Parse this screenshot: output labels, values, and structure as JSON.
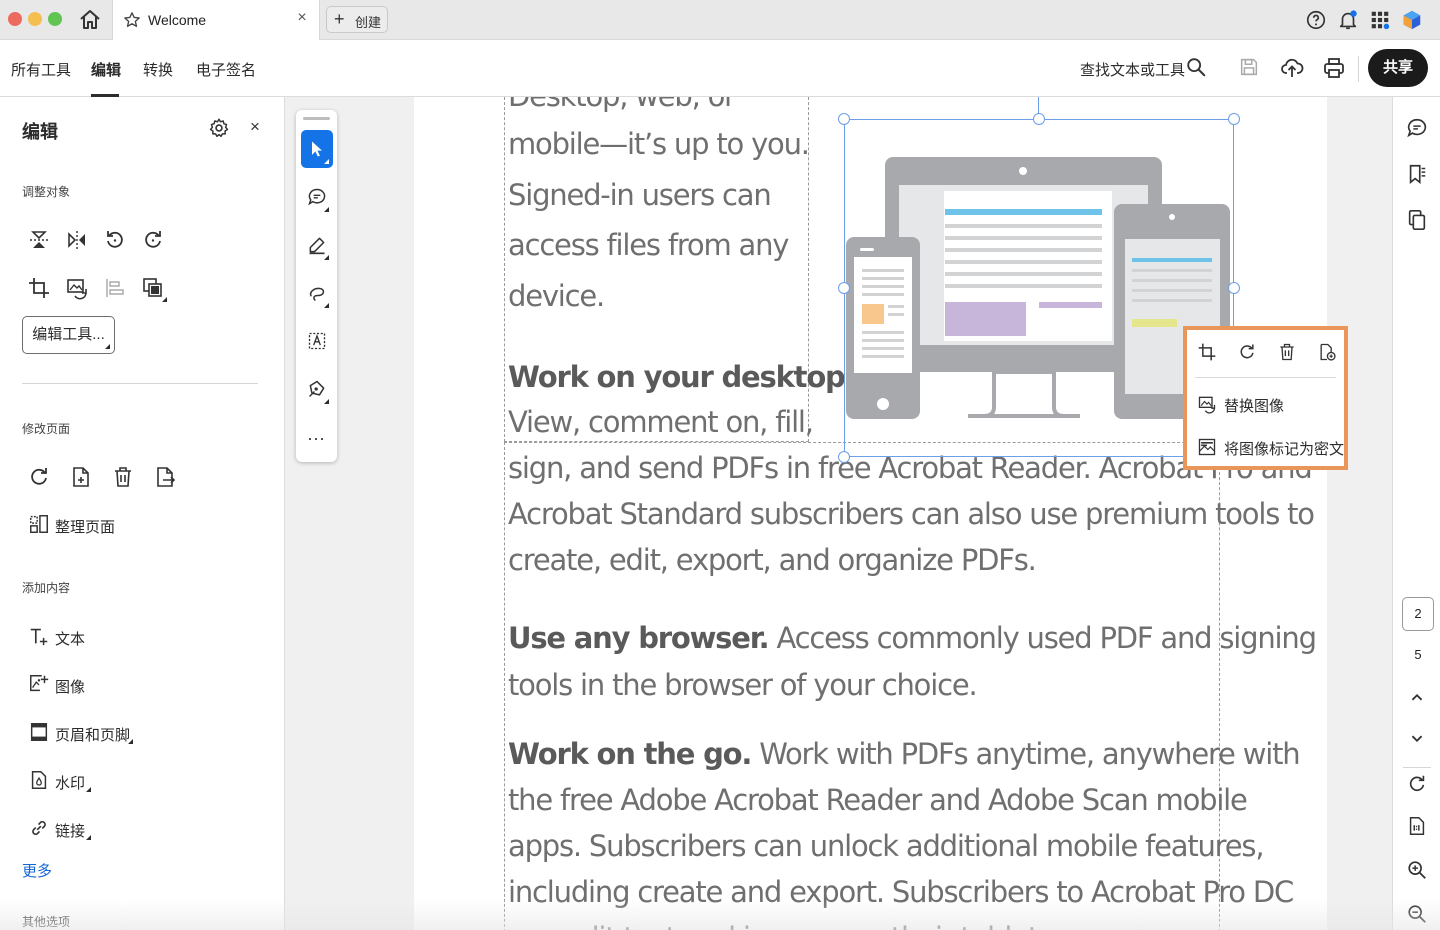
{
  "window": {
    "tab_title": "Welcome",
    "tab_close": "×",
    "new_tab_plus": "+",
    "new_tab_label": "创建",
    "icons": [
      "home-icon",
      "star-icon",
      "help-icon",
      "notification-bell-icon",
      "apps-grid-icon",
      "adobe-cloud-icon"
    ],
    "traffic_colors": [
      "#ed6a5e",
      "#f5bf4f",
      "#61c554"
    ]
  },
  "menubar": {
    "items": [
      {
        "label": "所有工具"
      },
      {
        "label": "编辑"
      },
      {
        "label": "转换"
      },
      {
        "label": "电子签名"
      }
    ],
    "active_index": 1,
    "search_label": "查找文本或工具",
    "share_label": "共享",
    "icons": [
      "search-icon",
      "save-icon",
      "cloud-upload-icon",
      "print-icon"
    ]
  },
  "left_panel": {
    "title": "编辑",
    "close": "×",
    "sections": {
      "adjust_objects": "调整对象",
      "modify_pages": "修改页面",
      "add_content": "添加内容",
      "other_options": "其他选项"
    },
    "edit_tools_button": "编辑工具...",
    "organize_pages": "整理页面",
    "add_items": [
      {
        "label": "文本",
        "icon": "add-text-icon"
      },
      {
        "label": "图像",
        "icon": "add-image-icon"
      },
      {
        "label": "页眉和页脚",
        "icon": "header-footer-icon"
      },
      {
        "label": "水印",
        "icon": "watermark-icon"
      },
      {
        "label": "链接",
        "icon": "link-icon"
      }
    ],
    "more_link": "更多"
  },
  "toolstrip": {
    "more": "···"
  },
  "document": {
    "col1_lines": [
      "Desktop, web, or",
      "mobile—it’s up to you.",
      "Signed-in users can",
      "access files from any",
      "device."
    ],
    "desktop_heading": "Work on your desktop.",
    "desktop_line1": "View, comment on, fill,",
    "desktop_lines": [
      "sign, and send PDFs in free Acrobat Reader. Acrobat Pro and",
      "Acrobat Standard subscribers can also use premium tools to",
      "create, edit, export, and organize PDFs."
    ],
    "browser_heading": "Use any browser.",
    "browser_line1_rest": " Access commonly used PDF and signing",
    "browser_line2": "tools in the browser of your choice.",
    "go_heading": "Work on the go.",
    "go_line1_rest": " Work with PDFs anytime, anywhere with",
    "go_lines": [
      "the free Adobe Acrobat Reader and Adobe Scan mobile",
      "apps. Subscribers can unlock additional mobile features,",
      "including create and export. Subscribers to Acrobat Pro DC",
      "can edit text and images on their tablet."
    ],
    "image_colors": {
      "frame": "#a7a9ac",
      "screen": "#e6e7e8",
      "accent_blue": "#6fc3e8",
      "accent_purple": "#c7b6d9",
      "accent_orange": "#f7c78e"
    }
  },
  "context_menu": {
    "icons": [
      "crop-icon",
      "rotate-icon",
      "delete-icon",
      "replace-file-icon"
    ],
    "replace_image": "替换图像",
    "mark_as_artifact": "将图像标记为密文",
    "border_color": "#e8965a"
  },
  "right_rail": {
    "current_page": "2",
    "total_pages": "5"
  }
}
